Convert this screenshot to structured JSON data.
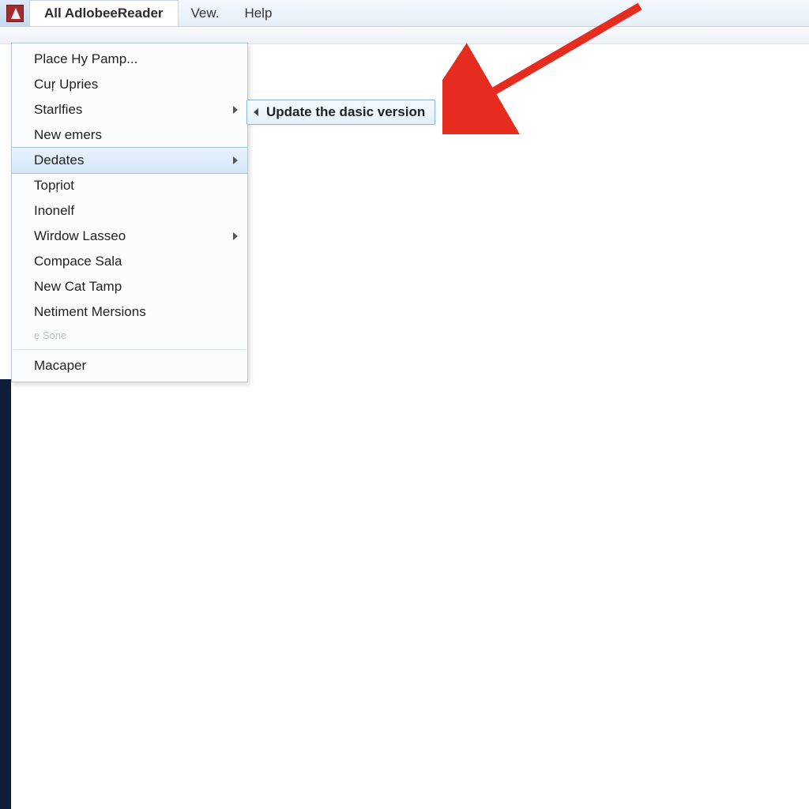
{
  "menubar": {
    "tab_label": "All AdlobeeReader",
    "items": [
      "Vew.",
      "Help"
    ]
  },
  "dropdown": {
    "items": [
      {
        "label": "Place Hy Pamp...",
        "has_submenu": false
      },
      {
        "label": "Cuŗ Upries",
        "has_submenu": false
      },
      {
        "label": "Starlfies",
        "has_submenu": true
      },
      {
        "label": "New emers",
        "has_submenu": false
      },
      {
        "label": "Dedates",
        "has_submenu": true,
        "highlighted": true
      },
      {
        "label": "Topŗiot",
        "has_submenu": false
      },
      {
        "label": "Inonelf",
        "has_submenu": false
      },
      {
        "label": "Wirdow Lasseo",
        "has_submenu": true
      },
      {
        "label": "Compace Sala",
        "has_submenu": false
      },
      {
        "label": "New Cat Tamp",
        "has_submenu": false
      },
      {
        "label": "Netiment Mersions",
        "has_submenu": false
      }
    ],
    "disabled_item": "ẹ Sone",
    "footer_item": "Macaper"
  },
  "submenu": {
    "label": "Update the dasic version"
  },
  "annotation": {
    "color": "#e62b1f"
  }
}
